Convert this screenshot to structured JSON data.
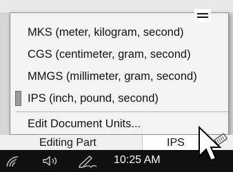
{
  "units_menu": {
    "items": [
      {
        "label": "MKS (meter, kilogram, second)",
        "checked": false
      },
      {
        "label": "CGS (centimeter, gram, second)",
        "checked": false
      },
      {
        "label": "MMGS (millimeter, gram, second)",
        "checked": false
      },
      {
        "label": "IPS (inch, pound, second)",
        "checked": true
      }
    ],
    "edit_label": "Edit Document Units..."
  },
  "status_bar": {
    "editing_label": "Editing Part",
    "units_value": "IPS",
    "units_arrow_icon": "caret-up-icon",
    "rebuild_icon": "rebuild-indicator-icon"
  },
  "taskbar": {
    "clock": "10:25 AM",
    "icons": [
      "wifi-icon",
      "speaker-icon",
      "pen-icon",
      "notification-icon"
    ]
  }
}
